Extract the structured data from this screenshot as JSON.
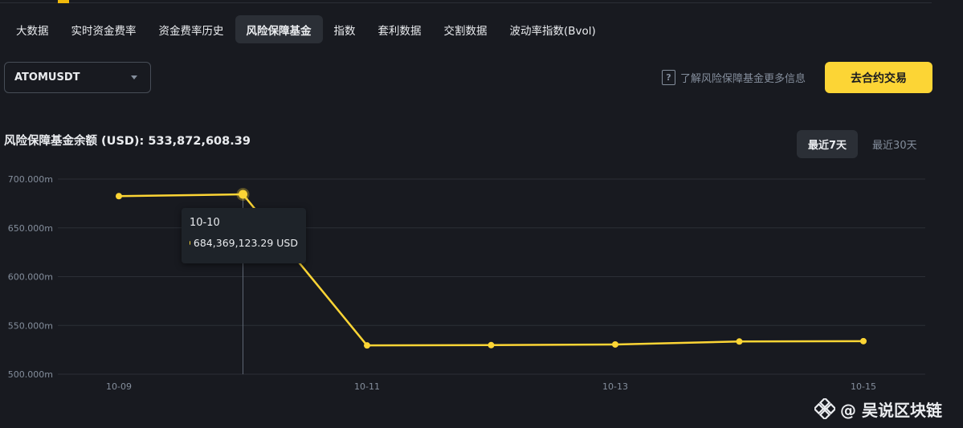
{
  "tabs": [
    {
      "label": "大数据"
    },
    {
      "label": "实时资金费率"
    },
    {
      "label": "资金费率历史"
    },
    {
      "label": "风险保障基金",
      "active": true
    },
    {
      "label": "指数"
    },
    {
      "label": "套利数据"
    },
    {
      "label": "交割数据"
    },
    {
      "label": "波动率指数(Bvol)"
    }
  ],
  "symbol_select": {
    "value": "ATOMUSDT",
    "icon": "chevron-down-icon"
  },
  "info_link": {
    "label": "了解风险保障基金更多信息",
    "icon": "question-icon"
  },
  "trade_button": {
    "label": "去合约交易"
  },
  "balance": {
    "label": "风险保障基金余额 (USD): 533,872,608.39"
  },
  "range_buttons": [
    {
      "label": "最近7天",
      "active": true
    },
    {
      "label": "最近30天"
    }
  ],
  "tooltip": {
    "date": "10-10",
    "value": "684,369,123.29 USD"
  },
  "watermark": {
    "label": "@ 吴说区块链",
    "icon": "binance-logo-icon"
  },
  "colors": {
    "background": "#181a20",
    "accent": "#fcd535",
    "muted": "#848e9c"
  },
  "chart_data": {
    "type": "line",
    "x": [
      "10-09",
      "10-10",
      "10-11",
      "10-12",
      "10-13",
      "10-14",
      "10-15"
    ],
    "x_tick_labels": [
      "10-09",
      "10-11",
      "10-13",
      "10-15"
    ],
    "values": [
      682.5,
      684.369,
      529.5,
      529.8,
      530.5,
      533.5,
      533.873
    ],
    "y_ticks": [
      "700.000m",
      "650.000m",
      "600.000m",
      "550.000m",
      "500.000m"
    ],
    "ylim": [
      500,
      700
    ],
    "highlighted_index": 1,
    "grid": true
  }
}
